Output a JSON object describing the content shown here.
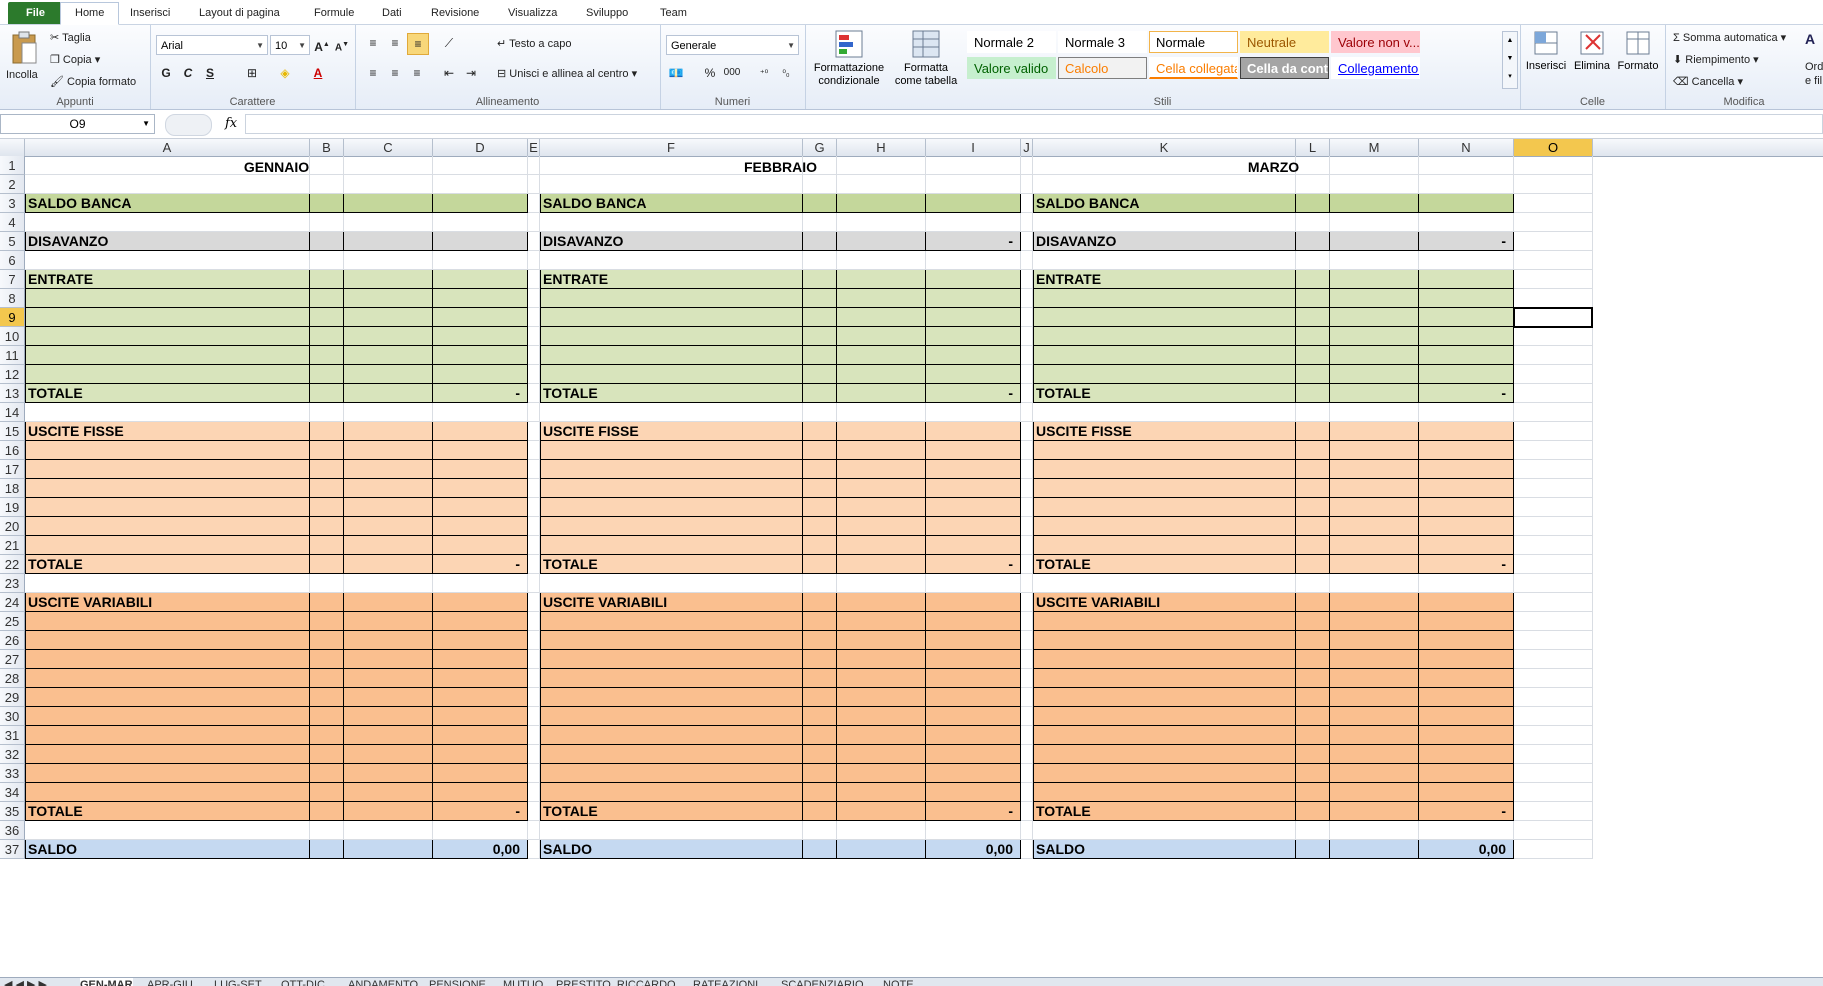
{
  "tabs": {
    "file": "File",
    "items": [
      "Home",
      "Inserisci",
      "Layout di pagina",
      "Formule",
      "Dati",
      "Revisione",
      "Visualizza",
      "Sviluppo",
      "Team"
    ]
  },
  "ribbon": {
    "clipboard": {
      "paste": "Incolla",
      "cut": "Taglia",
      "copy": "Copia",
      "format_painter": "Copia formato",
      "group": "Appunti"
    },
    "font": {
      "name": "Arial",
      "size": "10",
      "bold": "G",
      "italic": "C",
      "underline": "S",
      "group": "Carattere"
    },
    "alignment": {
      "wrap": "Testo a capo",
      "merge": "Unisci e allinea al centro",
      "group": "Allineamento"
    },
    "number": {
      "format": "Generale",
      "percent": "%",
      "thousands": "000",
      "group": "Numeri"
    },
    "styles": {
      "conditional": "Formattazione condizionale",
      "table": "Formatta come tabella",
      "group": "Stili",
      "cells": [
        {
          "label": "Normale 2",
          "bg": "#ffffff",
          "fg": "#000000",
          "border": "#ffffff"
        },
        {
          "label": "Normale 3",
          "bg": "#ffffff",
          "fg": "#000000",
          "border": "#ffffff"
        },
        {
          "label": "Normale",
          "bg": "#ffffff",
          "fg": "#000000",
          "border": "#f2b44a"
        },
        {
          "label": "Neutrale",
          "bg": "#ffeb9c",
          "fg": "#9c5700",
          "border": "#ffeb9c"
        },
        {
          "label": "Valore non v...",
          "bg": "#ffc7ce",
          "fg": "#9c0006",
          "border": "#ffc7ce"
        },
        {
          "label": "Valore valido",
          "bg": "#c6efce",
          "fg": "#006100",
          "border": "#c6efce"
        },
        {
          "label": "Calcolo",
          "bg": "#f2f2f2",
          "fg": "#fa7d00",
          "border": "#7f7f7f"
        },
        {
          "label": "Cella collegata",
          "bg": "#ffffff",
          "fg": "#fa7d00",
          "border": "#ffffff"
        },
        {
          "label": "Cella da cont...",
          "bg": "#a5a5a5",
          "fg": "#ffffff",
          "border": "#3f3f3f"
        },
        {
          "label": "Collegamento...",
          "bg": "#ffffff",
          "fg": "#0000ff",
          "border": "#ffffff"
        }
      ]
    },
    "cells": {
      "insert": "Inserisci",
      "delete": "Elimina",
      "format": "Formato",
      "group": "Celle"
    },
    "editing": {
      "autosum": "Somma automatica",
      "fill": "Riempimento",
      "clear": "Cancella",
      "sort": "Ord",
      "sort2": "e fil",
      "group": "Modifica"
    }
  },
  "formula_bar": {
    "cell_ref": "O9",
    "fx": "fx",
    "value": ""
  },
  "columns": [
    "A",
    "B",
    "C",
    "D",
    "E",
    "F",
    "G",
    "H",
    "I",
    "J",
    "K",
    "L",
    "M",
    "N",
    "O"
  ],
  "selected_column": "O",
  "selected_row": 9,
  "rows": [
    "1",
    "2",
    "3",
    "4",
    "5",
    "6",
    "7",
    "8",
    "9",
    "10",
    "11",
    "12",
    "13",
    "14",
    "15",
    "16",
    "17",
    "18",
    "19",
    "20",
    "21",
    "22",
    "23",
    "24",
    "25",
    "26",
    "27",
    "28",
    "29",
    "30",
    "31",
    "32",
    "33",
    "34",
    "35",
    "36",
    "37"
  ],
  "months": [
    "GENNAIO",
    "FEBBRAIO",
    "MARZO"
  ],
  "sections": {
    "saldo_banca": "SALDO BANCA",
    "disavanzo": "DISAVANZO",
    "entrate": "ENTRATE",
    "uscite_fisse": "USCITE FISSE",
    "uscite_variabili": "USCITE VARIABILI",
    "totale": "TOTALE",
    "saldo": "SALDO"
  },
  "values": {
    "dash": "-",
    "saldo": "0,00"
  },
  "colors": {
    "saldo_banca": "#c4d79b",
    "disavanzo": "#d9d9d9",
    "entrate": "#d8e4bc",
    "uscite_fisse": "#fcd5b4",
    "uscite_variabili": "#fabf8f",
    "saldo": "#c5d9f1",
    "selection": "#f3c74e"
  },
  "sheet_tabs": [
    "GEN-MAR",
    "APR-GIU",
    "LUG-SET",
    "OTT-DIC",
    "ANDAMENTO",
    "PENSIONE",
    "MUTUO",
    "PRESTITO_RICCARDO",
    "RATEAZIONI",
    "SCADENZIARIO",
    "NOTE"
  ]
}
